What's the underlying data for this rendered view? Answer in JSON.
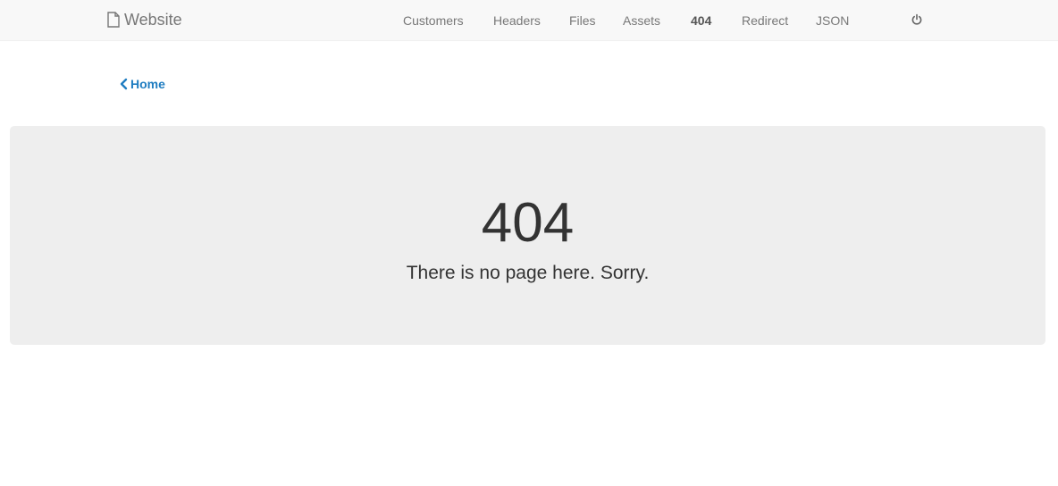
{
  "navbar": {
    "brand_label": "Website",
    "brand_icon": "file-icon",
    "links": [
      {
        "label": "Customers"
      },
      {
        "label": "Headers"
      },
      {
        "label": "Files"
      },
      {
        "label": "Assets"
      },
      {
        "label": "404",
        "active": true
      },
      {
        "label": "Redirect"
      },
      {
        "label": "JSON"
      }
    ],
    "power_icon": "power-icon"
  },
  "back": {
    "label": "Home",
    "icon": "chevron-left-icon",
    "color": "#1f7dc1"
  },
  "jumbotron": {
    "title": "404",
    "message": "There is no page here. Sorry."
  }
}
